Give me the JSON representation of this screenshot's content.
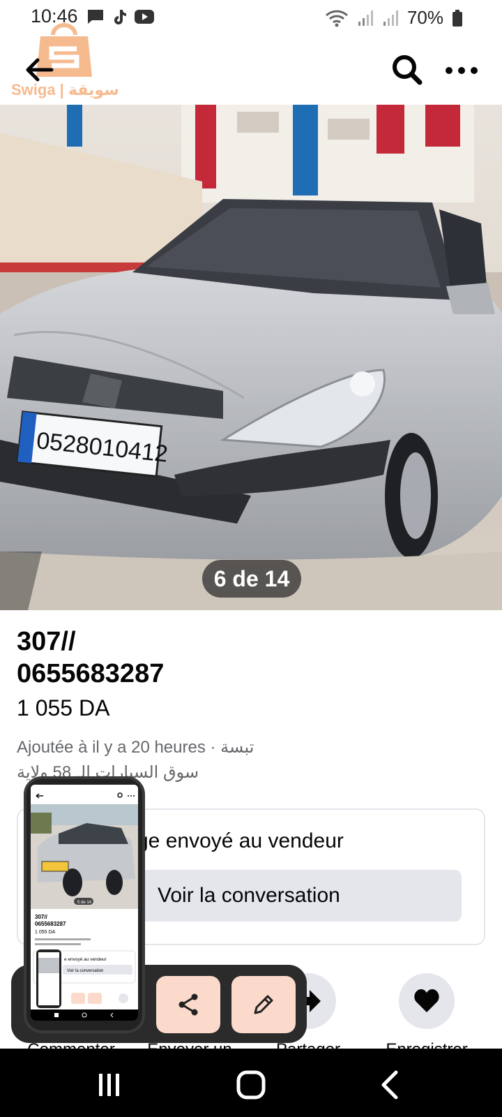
{
  "status_bar": {
    "time": "10:46",
    "battery": "70%",
    "icons_left": [
      "chat-icon",
      "tiktok-icon",
      "youtube-icon"
    ],
    "icons_right": [
      "wifi-icon",
      "signal-icon",
      "signal-icon",
      "battery-icon"
    ]
  },
  "watermark": {
    "text": "Swiga | سويقة"
  },
  "app_bar": {
    "icons": [
      "back-arrow-icon",
      "search-icon",
      "more-icon"
    ]
  },
  "photo": {
    "counter": "6 de 14",
    "plate": "0528010412"
  },
  "listing": {
    "title_line1": "307//",
    "title_line2": "0655683287",
    "price": "1 055 DA",
    "added": "Ajoutée à il y a 20 heures · تبسة",
    "category": "سوق السيارات الـ 58 ولاية"
  },
  "message_card": {
    "status": "ge envoyé au vendeur",
    "button": "Voir la conversation"
  },
  "actions": [
    {
      "label": "Commenter",
      "icon": "comment-icon"
    },
    {
      "label": "Envoyer un",
      "icon": "send-icon"
    },
    {
      "label": "Partager",
      "icon": "share-arrow-icon"
    },
    {
      "label": "Enregistrer",
      "icon": "heart-icon"
    }
  ],
  "thumbnail": {
    "counter": "5 de 14",
    "title_line1": "307//",
    "title_line2": "0655683287",
    "price": "1 055 DA",
    "msg": "e envoyé au vendeur",
    "button": "Voir la conversation",
    "plate": "0528010412"
  },
  "colors": {
    "accent_light": "#fcdacb",
    "grey_button": "#e4e6eb",
    "meta_text": "#65676b"
  }
}
